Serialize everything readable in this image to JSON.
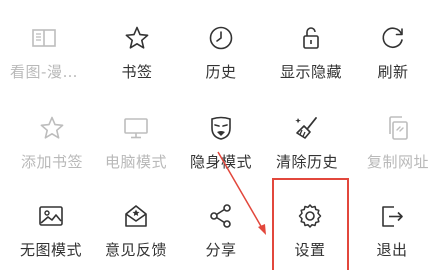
{
  "menu": {
    "rows": [
      [
        {
          "label": "看图-漫…",
          "icon": "book-icon",
          "disabled": true
        },
        {
          "label": "书签",
          "icon": "star-icon",
          "disabled": false
        },
        {
          "label": "历史",
          "icon": "clock-icon",
          "disabled": false
        },
        {
          "label": "显示隐藏",
          "icon": "lock-icon",
          "disabled": false
        },
        {
          "label": "刷新",
          "icon": "refresh-icon",
          "disabled": false
        }
      ],
      [
        {
          "label": "添加书签",
          "icon": "star-icon",
          "disabled": true
        },
        {
          "label": "电脑模式",
          "icon": "monitor-icon",
          "disabled": true
        },
        {
          "label": "隐身模式",
          "icon": "mask-icon",
          "disabled": false
        },
        {
          "label": "清除历史",
          "icon": "broom-icon",
          "disabled": false
        },
        {
          "label": "复制网址",
          "icon": "copy-icon",
          "disabled": true
        }
      ],
      [
        {
          "label": "无图模式",
          "icon": "image-icon",
          "disabled": false
        },
        {
          "label": "意见反馈",
          "icon": "feedback-icon",
          "disabled": false
        },
        {
          "label": "分享",
          "icon": "share-icon",
          "disabled": false
        },
        {
          "label": "设置",
          "icon": "settings-icon",
          "disabled": false
        },
        {
          "label": "退出",
          "icon": "exit-icon",
          "disabled": false
        }
      ]
    ]
  },
  "colors": {
    "text": "#333333",
    "disabled": "#b9b9b9",
    "highlight": "#e2473c"
  }
}
